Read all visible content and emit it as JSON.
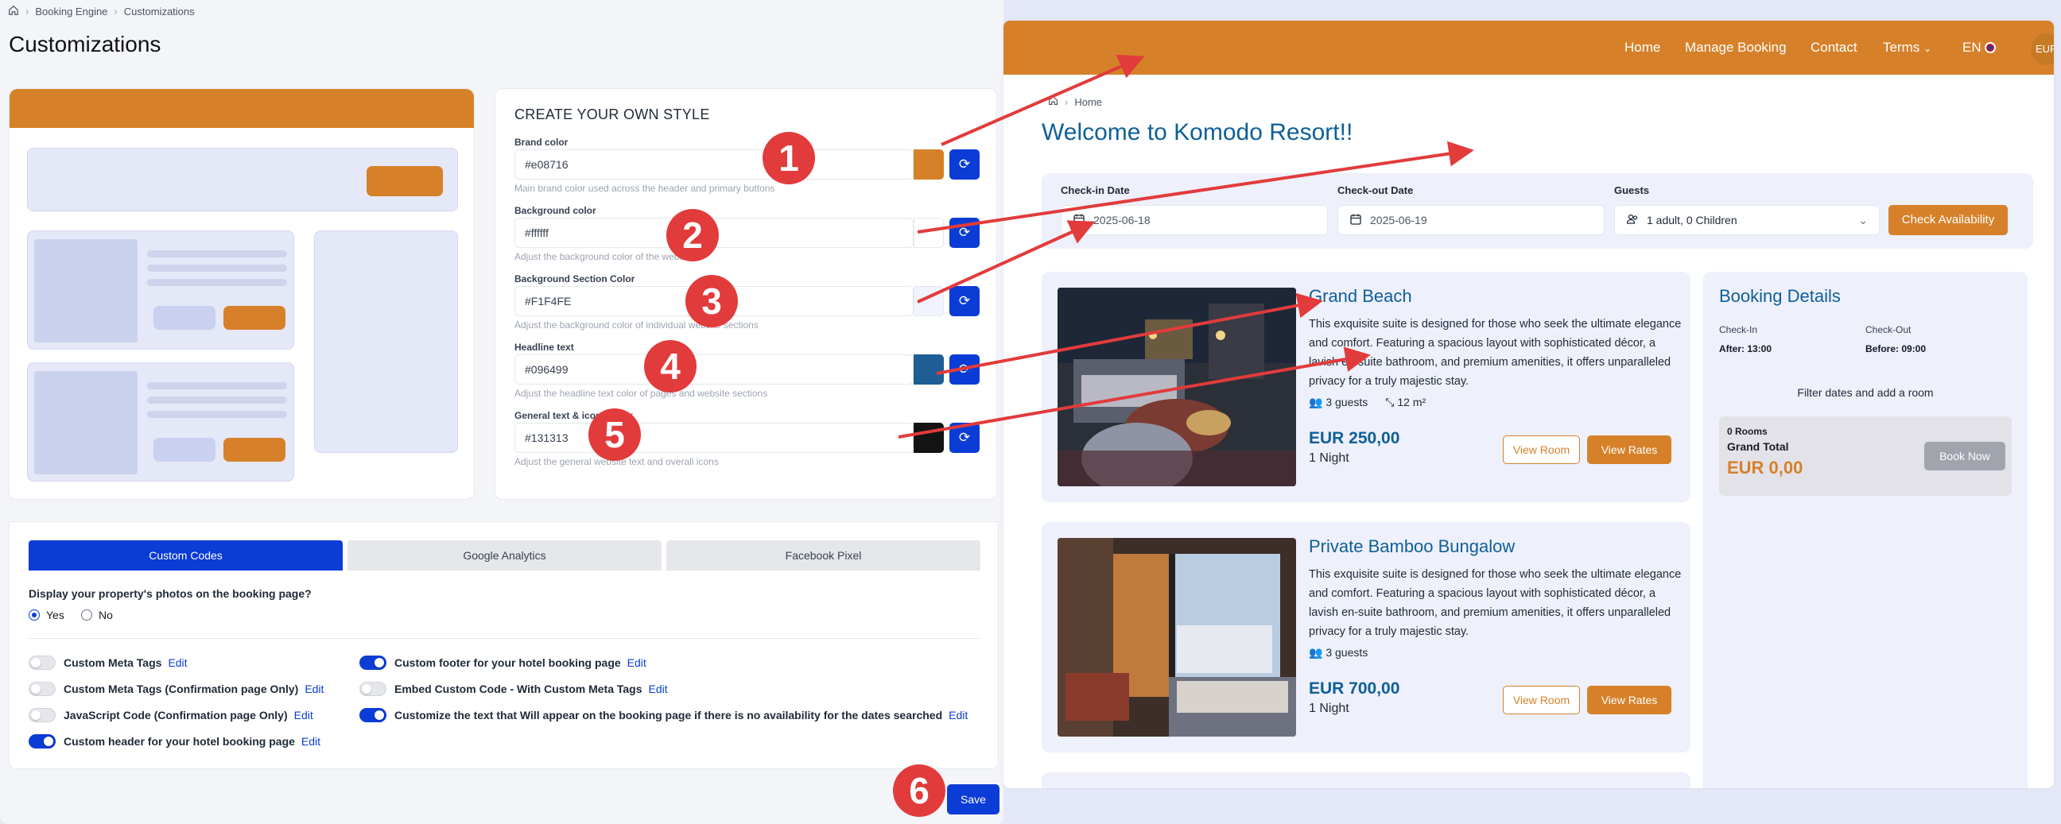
{
  "admin": {
    "breadcrumb": [
      "Booking Engine",
      "Customizations"
    ],
    "title": "Customizations",
    "style_panel": {
      "title": "CREATE YOUR OWN STYLE",
      "fields": [
        {
          "label": "Brand color",
          "value": "#e08716",
          "swatch": "#d6812a",
          "help": "Main brand color used across the header and primary buttons"
        },
        {
          "label": "Background color",
          "value": "#ffffff",
          "swatch": "#ffffff",
          "help": "Adjust the background color of the website"
        },
        {
          "label": "Background Section Color",
          "value": "#F1F4FE",
          "swatch": "#f1f4fe",
          "help": "Adjust the background color of individual website sections"
        },
        {
          "label": "Headline text",
          "value": "#096499",
          "swatch": "#1e5e95",
          "help": "Adjust the headline text color of pages and website sections"
        },
        {
          "label": "General text & icons color",
          "value": "#131313",
          "swatch": "#131313",
          "help": "Adjust the general website text and overall icons"
        }
      ]
    },
    "tabs": [
      "Custom Codes",
      "Google Analytics",
      "Facebook Pixel"
    ],
    "question": "Display your property's photos on the booking page?",
    "radio_yes": "Yes",
    "radio_no": "No",
    "toggles_left": [
      {
        "label": "Custom Meta Tags",
        "edit": "Edit",
        "on": false
      },
      {
        "label": "Custom Meta Tags (Confirmation page Only)",
        "edit": "Edit",
        "on": false
      },
      {
        "label": "JavaScript Code (Confirmation page Only)",
        "edit": "Edit",
        "on": false
      },
      {
        "label": "Custom header for your hotel booking page",
        "edit": "Edit",
        "on": true
      }
    ],
    "toggles_right": [
      {
        "label": "Custom footer for your hotel booking page",
        "edit": "Edit",
        "on": true
      },
      {
        "label": "Embed Custom Code - With Custom Meta Tags",
        "edit": "Edit",
        "on": false
      },
      {
        "label": "Customize the text that Will appear on the booking page if there is no availability for the dates searched",
        "edit": "Edit",
        "on": true
      }
    ],
    "save_label": "Save"
  },
  "site": {
    "nav": {
      "home": "Home",
      "manage": "Manage Booking",
      "contact": "Contact",
      "terms": "Terms",
      "lang": "EN",
      "currency": "EUR"
    },
    "breadcrumb": "Home",
    "title": "Welcome to Komodo Resort!!",
    "search": {
      "checkin_label": "Check-in Date",
      "checkin_value": "2025-06-18",
      "checkout_label": "Check-out Date",
      "checkout_value": "2025-06-19",
      "guests_label": "Guests",
      "guests_value": "1 adult, 0 Children",
      "button": "Check Availability"
    },
    "rooms": [
      {
        "name": "Grand Beach",
        "description": "This exquisite suite is designed for those who seek the ultimate elegance and comfort. Featuring a spacious layout with sophisticated décor, a lavish en-suite bathroom, and premium amenities, it offers unparalleled privacy for a truly majestic stay.",
        "guests": "3 guests",
        "size": "12 m²",
        "price": "EUR 250,00",
        "nights": "1 Night",
        "view_room": "View Room",
        "view_rates": "View Rates"
      },
      {
        "name": "Private Bamboo Bungalow",
        "description": "This exquisite suite is designed for those who seek the ultimate elegance and comfort. Featuring a spacious layout with sophisticated décor, a lavish en-suite bathroom, and premium amenities, it offers unparalleled privacy for a truly majestic stay.",
        "guests": "3 guests",
        "price": "EUR 700,00",
        "nights": "1 Night",
        "view_room": "View Room",
        "view_rates": "View Rates"
      }
    ],
    "booking": {
      "title": "Booking Details",
      "checkin_label": "Check-In",
      "checkin_value": "After: 13:00",
      "checkout_label": "Check-Out",
      "checkout_value": "Before: 09:00",
      "filter_text": "Filter dates and add a room",
      "rooms_count": "0 Rooms",
      "total_label": "Grand Total",
      "total_value": "EUR 0,00",
      "book_button": "Book Now"
    }
  },
  "annotations": [
    "1",
    "2",
    "3",
    "4",
    "5",
    "6"
  ],
  "colors": {
    "brand": "#d6812a",
    "primary_blue": "#0b3cd6",
    "headline": "#0e5f98",
    "annotation_red": "#e23b3b"
  }
}
